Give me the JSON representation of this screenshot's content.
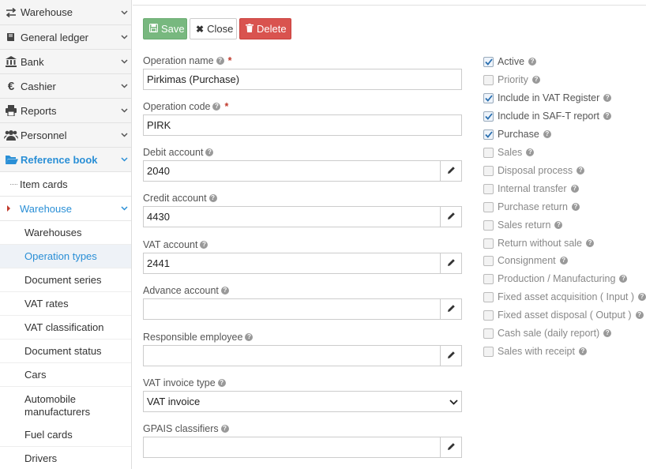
{
  "sidebar": {
    "items": [
      {
        "label": "Warehouse",
        "icon": "arrows-exchange-icon"
      },
      {
        "label": "General ledger",
        "icon": "book-icon"
      },
      {
        "label": "Bank",
        "icon": "bank-icon"
      },
      {
        "label": "Cashier",
        "icon": "euro-icon"
      },
      {
        "label": "Reports",
        "icon": "printer-icon"
      },
      {
        "label": "Personnel",
        "icon": "users-icon"
      },
      {
        "label": "Reference book",
        "icon": "folder-open-icon"
      }
    ],
    "sub_items": [
      {
        "label": "Item cards"
      },
      {
        "label": "Warehouse"
      }
    ],
    "leaves": [
      {
        "label": "Warehouses"
      },
      {
        "label": "Operation types"
      },
      {
        "label": "Document series"
      },
      {
        "label": "VAT rates"
      },
      {
        "label": "VAT classification"
      },
      {
        "label": "Document status"
      },
      {
        "label": "Cars"
      },
      {
        "label": "Automobile manufacturers"
      },
      {
        "label": "Fuel cards"
      },
      {
        "label": "Drivers"
      }
    ]
  },
  "toolbar": {
    "save_label": "Save",
    "close_label": "Close",
    "delete_label": "Delete"
  },
  "form": {
    "operation_name": {
      "label": "Operation name",
      "value": "Pirkimas (Purchase)"
    },
    "operation_code": {
      "label": "Operation code",
      "value": "PIRK"
    },
    "debit_account": {
      "label": "Debit account",
      "value": "2040"
    },
    "credit_account": {
      "label": "Credit account",
      "value": "4430"
    },
    "vat_account": {
      "label": "VAT account",
      "value": "2441"
    },
    "advance_account": {
      "label": "Advance account",
      "value": ""
    },
    "responsible_employee": {
      "label": "Responsible employee",
      "value": ""
    },
    "vat_invoice_type": {
      "label": "VAT invoice type",
      "value": "VAT invoice"
    },
    "gpais_classifiers": {
      "label": "GPAIS classifiers",
      "value": ""
    }
  },
  "checkboxes": [
    {
      "label": "Active",
      "checked": true
    },
    {
      "label": "Priority",
      "checked": false
    },
    {
      "label": "Include in VAT Register",
      "checked": true
    },
    {
      "label": "Include in SAF-T report",
      "checked": true
    },
    {
      "label": "Purchase",
      "checked": true
    },
    {
      "label": "Sales",
      "checked": false
    },
    {
      "label": "Disposal process",
      "checked": false
    },
    {
      "label": "Internal transfer",
      "checked": false
    },
    {
      "label": "Purchase return",
      "checked": false
    },
    {
      "label": "Sales return",
      "checked": false
    },
    {
      "label": "Return without sale",
      "checked": false
    },
    {
      "label": "Consignment",
      "checked": false
    },
    {
      "label": "Production / Manufacturing",
      "checked": false
    },
    {
      "label": "Fixed asset acquisition ( Input )",
      "checked": false
    },
    {
      "label": "Fixed asset disposal ( Output )",
      "checked": false
    },
    {
      "label": "Cash sale (daily report)",
      "checked": false
    },
    {
      "label": "Sales with receipt",
      "checked": false
    }
  ],
  "colors": {
    "accent": "#2a8fd6",
    "save": "#78b87f",
    "delete": "#d9534f",
    "required": "#c0392b"
  }
}
